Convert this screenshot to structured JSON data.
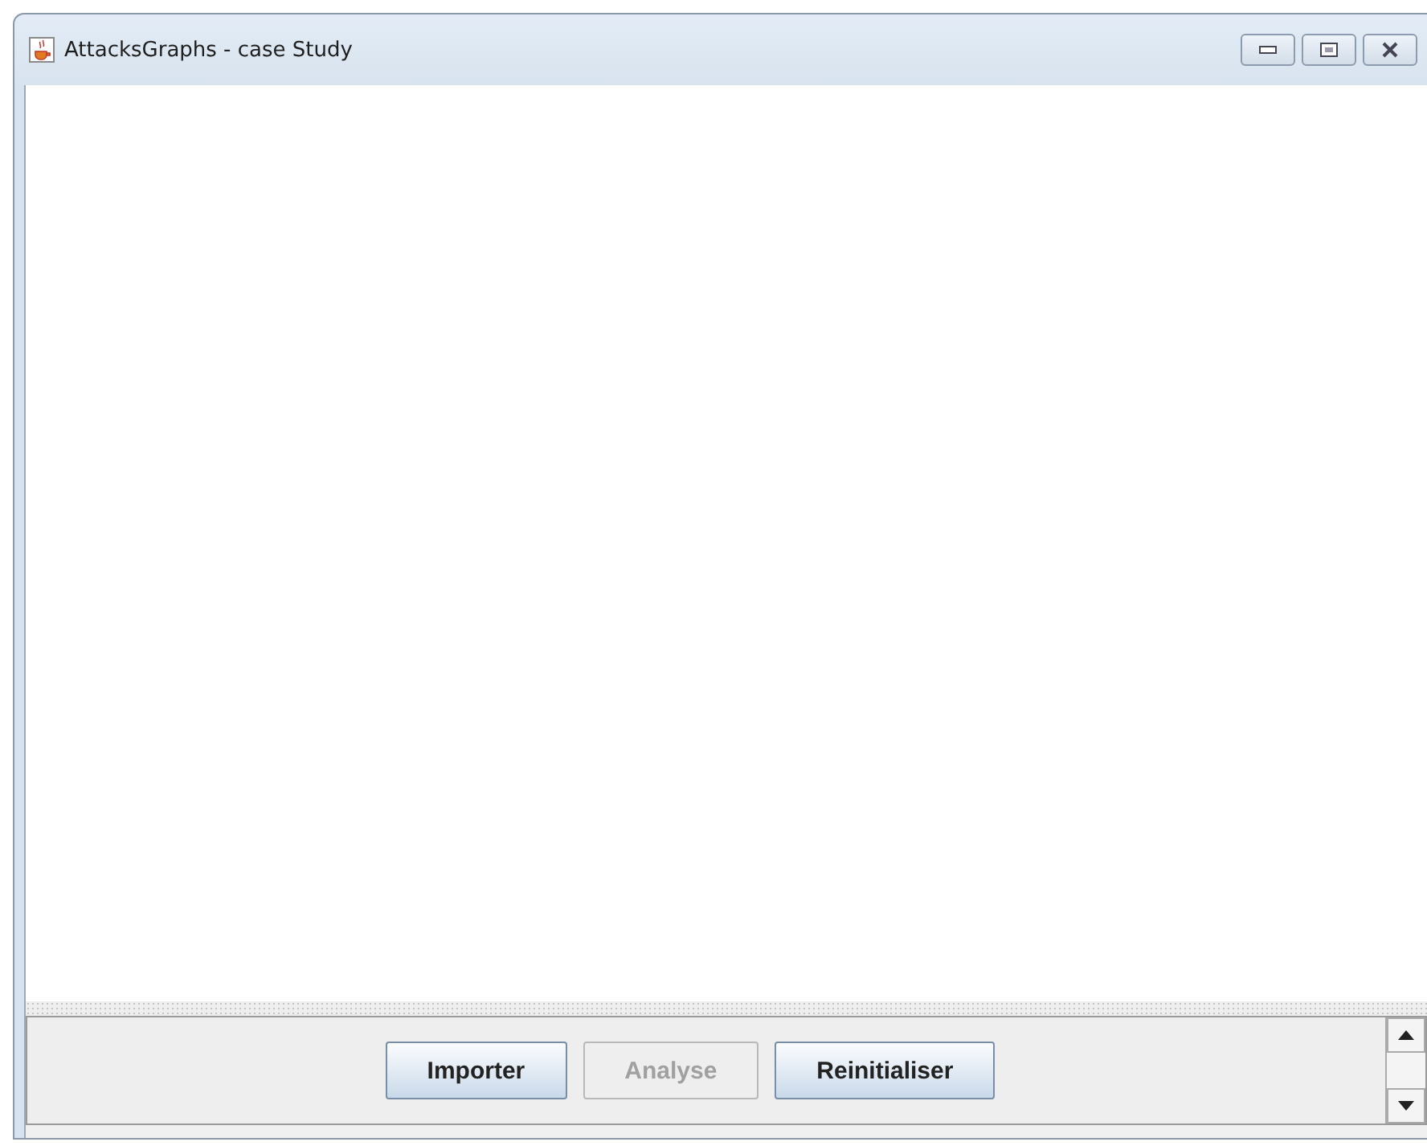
{
  "window": {
    "title": "AttacksGraphs - case Study"
  },
  "buttons": [
    {
      "label": "Importer",
      "disabled": false
    },
    {
      "label": "Analyse",
      "disabled": true
    },
    {
      "label": "Reinitialiser",
      "disabled": false
    }
  ]
}
